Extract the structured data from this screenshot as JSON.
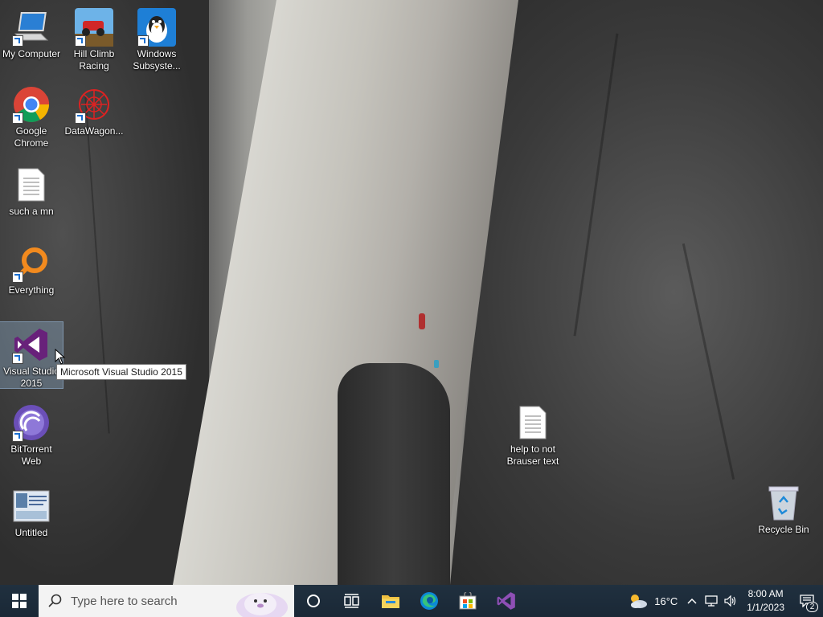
{
  "desktop": {
    "icons": [
      {
        "label": "My Computer",
        "icon": "computer-icon"
      },
      {
        "label": "Hill Climb Racing",
        "icon": "hill-climb-racing-icon"
      },
      {
        "label": "Windows Subsyste...",
        "icon": "penguin-icon"
      },
      {
        "label": "Google Chrome",
        "icon": "chrome-icon"
      },
      {
        "label": "DataWagon...",
        "icon": "datawagon-icon"
      },
      {
        "label": "such a mn",
        "icon": "text-file-icon"
      },
      {
        "label": "Everything",
        "icon": "everything-search-icon"
      },
      {
        "label": "Visual Studio 2015",
        "icon": "visual-studio-icon"
      },
      {
        "label": "BitTorrent Web",
        "icon": "bittorrent-icon"
      },
      {
        "label": "Untitled",
        "icon": "image-file-icon"
      },
      {
        "label": "help to not Brauser text",
        "icon": "text-file-icon"
      },
      {
        "label": "Recycle Bin",
        "icon": "recycle-bin-icon"
      }
    ],
    "tooltip": "Microsoft Visual Studio 2015"
  },
  "taskbar": {
    "search_placeholder": "Type here to search",
    "apps": [
      "task-view-icon",
      "file-explorer-icon",
      "edge-icon",
      "store-icon",
      "visual-studio-icon"
    ],
    "weather": "16°C",
    "time": "8:00 AM",
    "date": "1/1/2023",
    "notification_count": "2"
  },
  "colors": {
    "taskbar": "#1b2a3a",
    "search_bg": "#f3f3f3",
    "vs_purple": "#68217a",
    "selection": "#add6ff"
  }
}
